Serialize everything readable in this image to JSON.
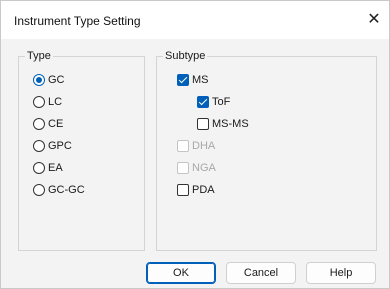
{
  "dialog": {
    "title": "Instrument Type Setting",
    "close_icon": "close-icon",
    "close_glyph": "✕"
  },
  "type_group": {
    "label": "Type",
    "options": [
      {
        "label": "GC",
        "checked": true
      },
      {
        "label": "LC",
        "checked": false
      },
      {
        "label": "CE",
        "checked": false
      },
      {
        "label": "GPC",
        "checked": false
      },
      {
        "label": "EA",
        "checked": false
      },
      {
        "label": "GC-GC",
        "checked": false
      }
    ]
  },
  "subtype_group": {
    "label": "Subtype",
    "options": [
      {
        "label": "MS",
        "checked": true,
        "enabled": true
      },
      {
        "label": "ToF",
        "checked": true,
        "enabled": true
      },
      {
        "label": "MS-MS",
        "checked": false,
        "enabled": true
      },
      {
        "label": "DHA",
        "checked": false,
        "enabled": false
      },
      {
        "label": "NGA",
        "checked": false,
        "enabled": false
      },
      {
        "label": "PDA",
        "checked": false,
        "enabled": true
      }
    ]
  },
  "buttons": {
    "ok": "OK",
    "cancel": "Cancel",
    "help": "Help"
  },
  "colors": {
    "accent": "#005fb8",
    "disabled_text": "#a8a8a8"
  }
}
